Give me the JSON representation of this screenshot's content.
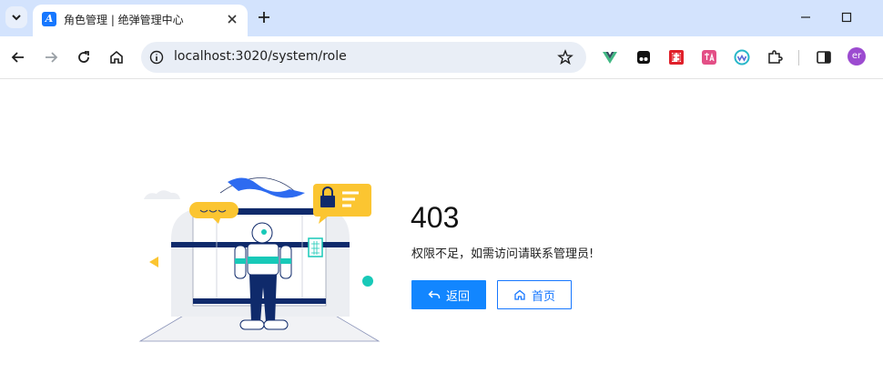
{
  "browser": {
    "tab_title": "角色管理 | 绝弹管理中心",
    "favicon_letter": "A",
    "url": "localhost:3020/system/role",
    "avatar_text": "er",
    "extension_icons": [
      "vue-devtools-icon",
      "tampermonkey-icon",
      "fe-helper-icon",
      "translate-icon",
      "wappalyzer-icon",
      "puzzle-icon"
    ]
  },
  "error": {
    "code": "403",
    "message": "权限不足，如需访问请联系管理员!"
  },
  "actions": {
    "back_label": "返回",
    "home_label": "首页"
  },
  "colors": {
    "primary": "#1286ff",
    "tabstrip": "#d3e3fd",
    "illustration_navy": "#0f2a6b",
    "illustration_teal": "#18c9b8",
    "illustration_yellow": "#fbc531"
  }
}
